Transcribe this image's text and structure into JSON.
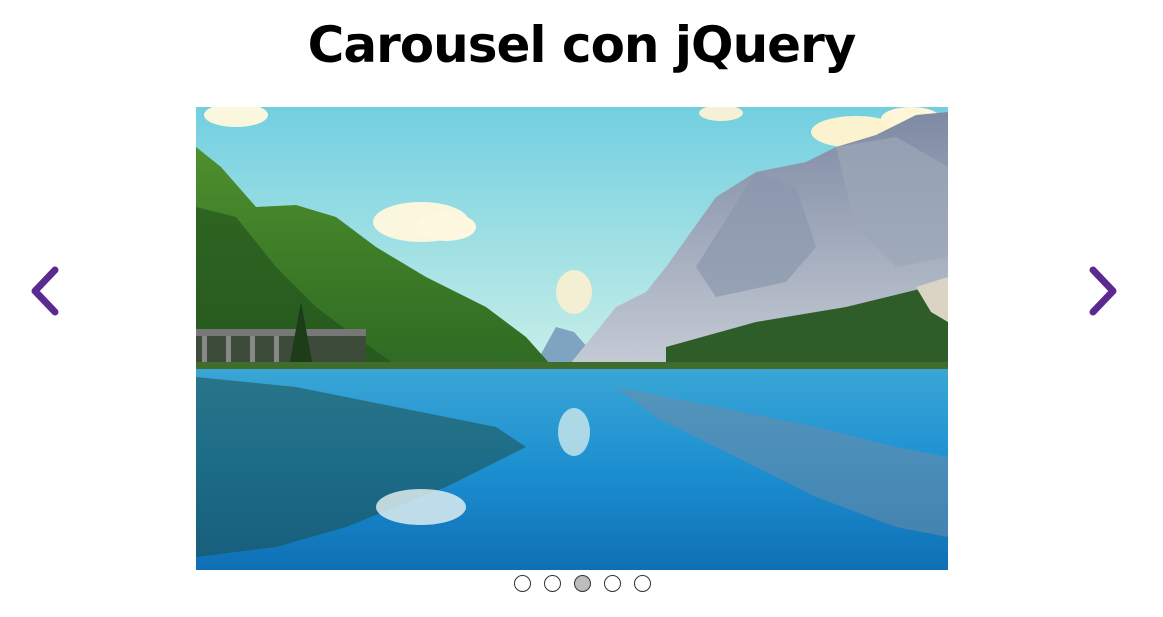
{
  "page": {
    "title": "Carousel con jQuery"
  },
  "carousel": {
    "prev_icon": "chevron-left-icon",
    "next_icon": "chevron-right-icon",
    "arrow_color": "#5b2a91",
    "slide_subject": "mountain-lake-landscape",
    "active_index": 2,
    "dots": [
      {
        "state": "inactive"
      },
      {
        "state": "inactive"
      },
      {
        "state": "active"
      },
      {
        "state": "inactive"
      },
      {
        "state": "inactive"
      }
    ]
  }
}
